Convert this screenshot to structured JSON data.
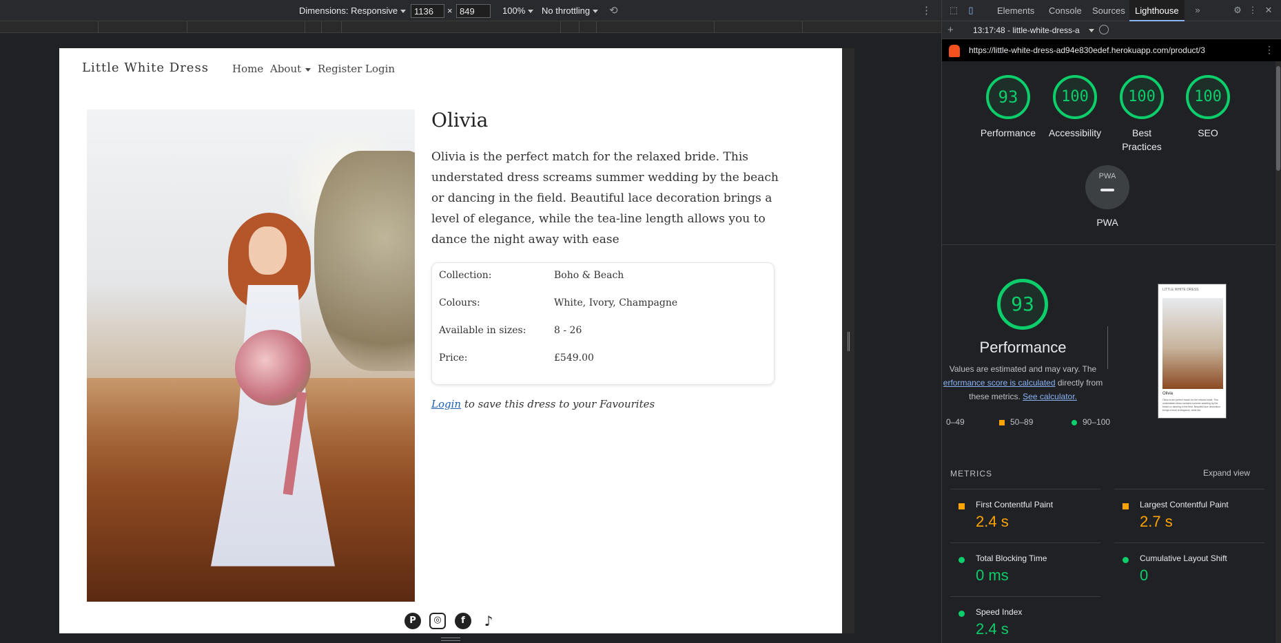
{
  "device_toolbar": {
    "dimensions_label": "Dimensions: Responsive",
    "width": "1136",
    "x": "×",
    "height": "849",
    "zoom": "100%",
    "throttling": "No throttling"
  },
  "site": {
    "brand": "Little White Dress",
    "nav": {
      "home": "Home",
      "about": "About",
      "register": "Register",
      "login": "Login"
    },
    "product": {
      "name": "Olivia",
      "description": "Olivia is the perfect match for the relaxed bride. This understated dress screams summer wedding by the beach or dancing in the field. Beautiful lace decoration brings a level of elegance, while the tea-line length allows you to dance the night away with ease",
      "specs": [
        {
          "label": "Collection:",
          "value": "Boho & Beach"
        },
        {
          "label": "Colours:",
          "value": "White, Ivory, Champagne"
        },
        {
          "label": "Available in sizes:",
          "value": "8 - 26"
        },
        {
          "label": "Price:",
          "value": "£549.00"
        }
      ],
      "login_link": "Login",
      "login_note": "to save this dress to your Favourites"
    },
    "social": [
      "pinterest-icon",
      "instagram-icon",
      "facebook-icon",
      "tiktok-icon"
    ]
  },
  "devtools": {
    "tabs": [
      "Elements",
      "Console",
      "Sources",
      "Lighthouse"
    ],
    "active_tab": "Lighthouse",
    "report_time": "13:17:48 - little-white-dress-a",
    "url": "https://little-white-dress-ad94e830edef.herokuapp.com/product/3",
    "scores": [
      {
        "label": "Performance",
        "score": "93"
      },
      {
        "label": "Accessibility",
        "score": "100"
      },
      {
        "label": "Best Practices",
        "score": "100"
      },
      {
        "label": "SEO",
        "score": "100"
      }
    ],
    "pwa": {
      "label": "PWA",
      "badge": "PWA"
    },
    "performance": {
      "score": "93",
      "title": "Performance",
      "note_pre": "Values are estimated and may vary. The",
      "note_link": "erformance score is calculated",
      "note_mid": "directly from these metrics.",
      "note_link2": "See calculator."
    },
    "legend": [
      "0–49",
      "50–89",
      "90–100"
    ],
    "metrics_header": "METRICS",
    "expand_view": "Expand view",
    "metrics": [
      {
        "label": "First Contentful Paint",
        "value": "2.4 s",
        "status": "average"
      },
      {
        "label": "Largest Contentful Paint",
        "value": "2.7 s",
        "status": "average"
      },
      {
        "label": "Total Blocking Time",
        "value": "0 ms",
        "status": "pass"
      },
      {
        "label": "Cumulative Layout Shift",
        "value": "0",
        "status": "pass"
      },
      {
        "label": "Speed Index",
        "value": "2.4 s",
        "status": "pass"
      }
    ],
    "colors": {
      "pass": "#0cce6b",
      "average": "#ffa400",
      "fail": "#ff4e42",
      "link": "#8ab4f8"
    }
  },
  "thumbnail": {
    "brand": "LITTLE WHITE DRESS",
    "name": "Olivia",
    "text": "Olivia is the perfect match for the relaxed bride. This understated dress screams summer wedding by the beach or dancing in the field. Beautiful lace decoration brings a level of elegance, while the"
  }
}
